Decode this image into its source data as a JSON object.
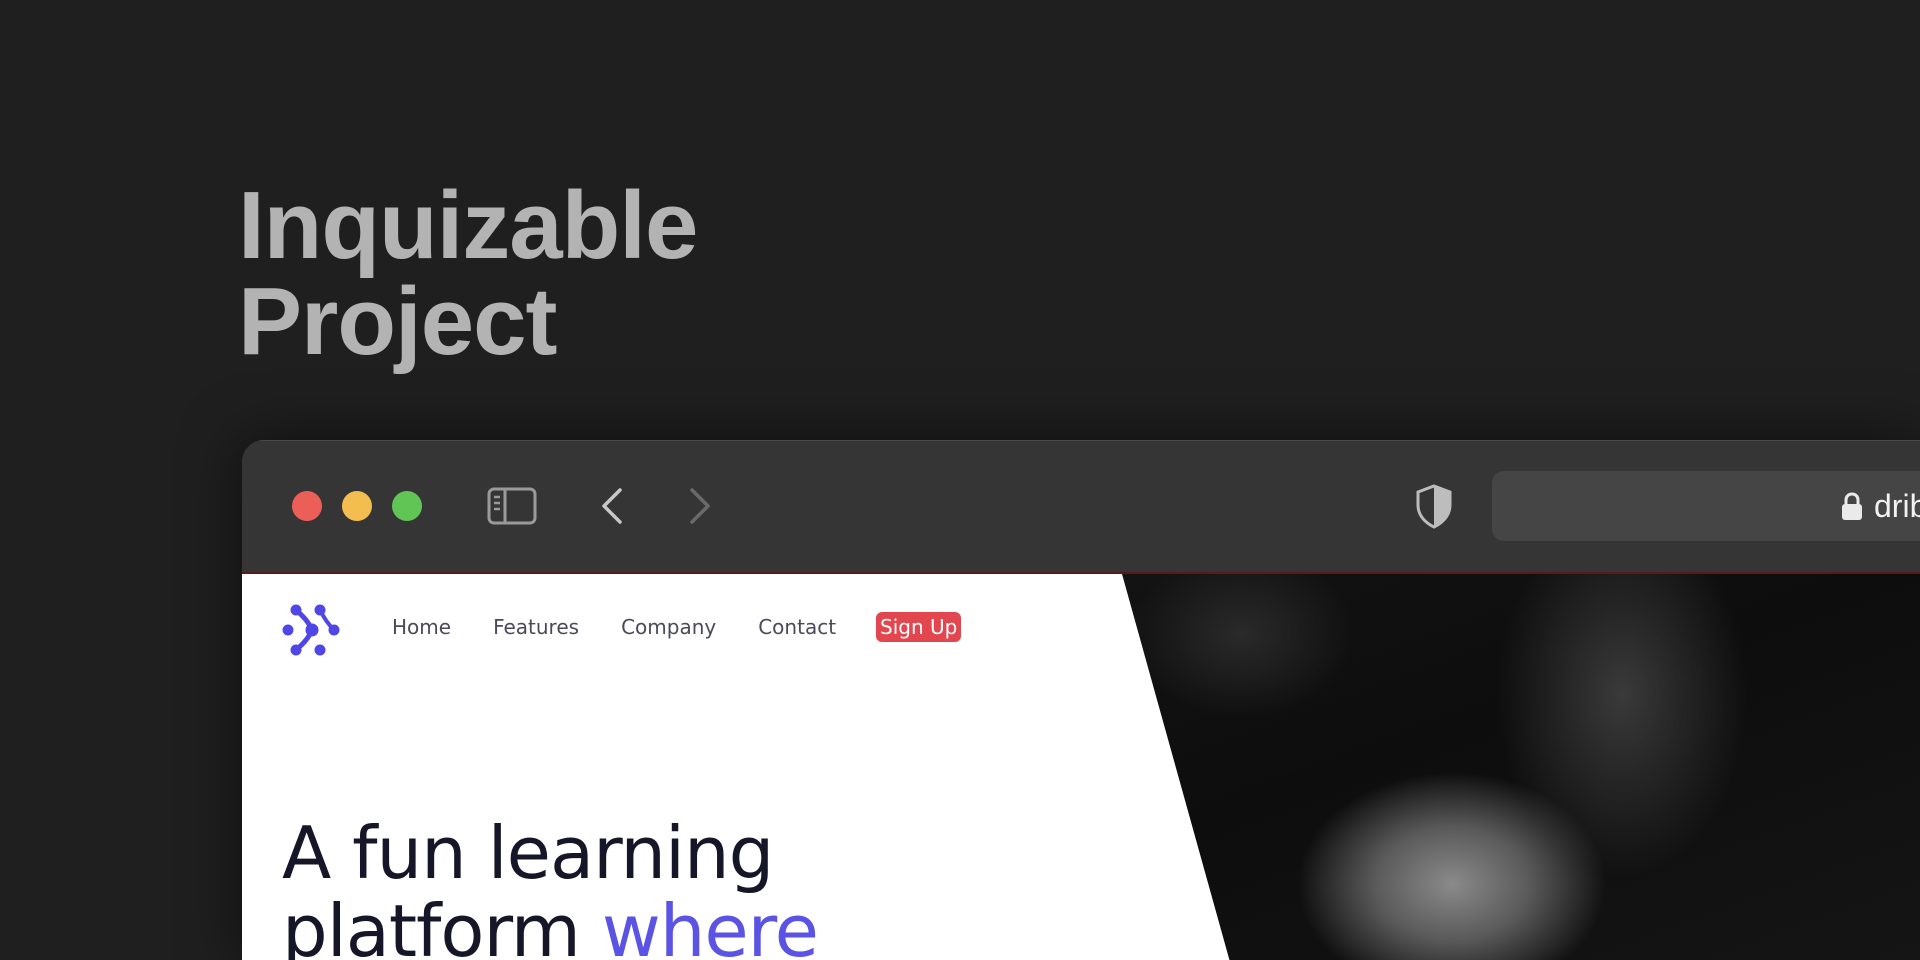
{
  "project": {
    "title_line1": "Inquizable",
    "title_line2": "Project"
  },
  "browser": {
    "url_text": "dribbble.com",
    "icons": {
      "sidebar": "sidebar-icon",
      "back": "chevron-left-icon",
      "forward": "chevron-right-icon",
      "shield": "shield-icon",
      "lock": "lock-icon"
    }
  },
  "site": {
    "nav": [
      {
        "label": "Home"
      },
      {
        "label": "Features"
      },
      {
        "label": "Company"
      },
      {
        "label": "Contact"
      }
    ],
    "signup_label": "Sign Up",
    "hero": {
      "line1": "A fun learning",
      "line2_start": "platform ",
      "line2_accent": "where"
    }
  },
  "colors": {
    "accent": "#5b53e3",
    "signup": "#e2464f",
    "traffic_red": "#ec5f59",
    "traffic_yellow": "#f4bd4f",
    "traffic_green": "#61c555"
  }
}
